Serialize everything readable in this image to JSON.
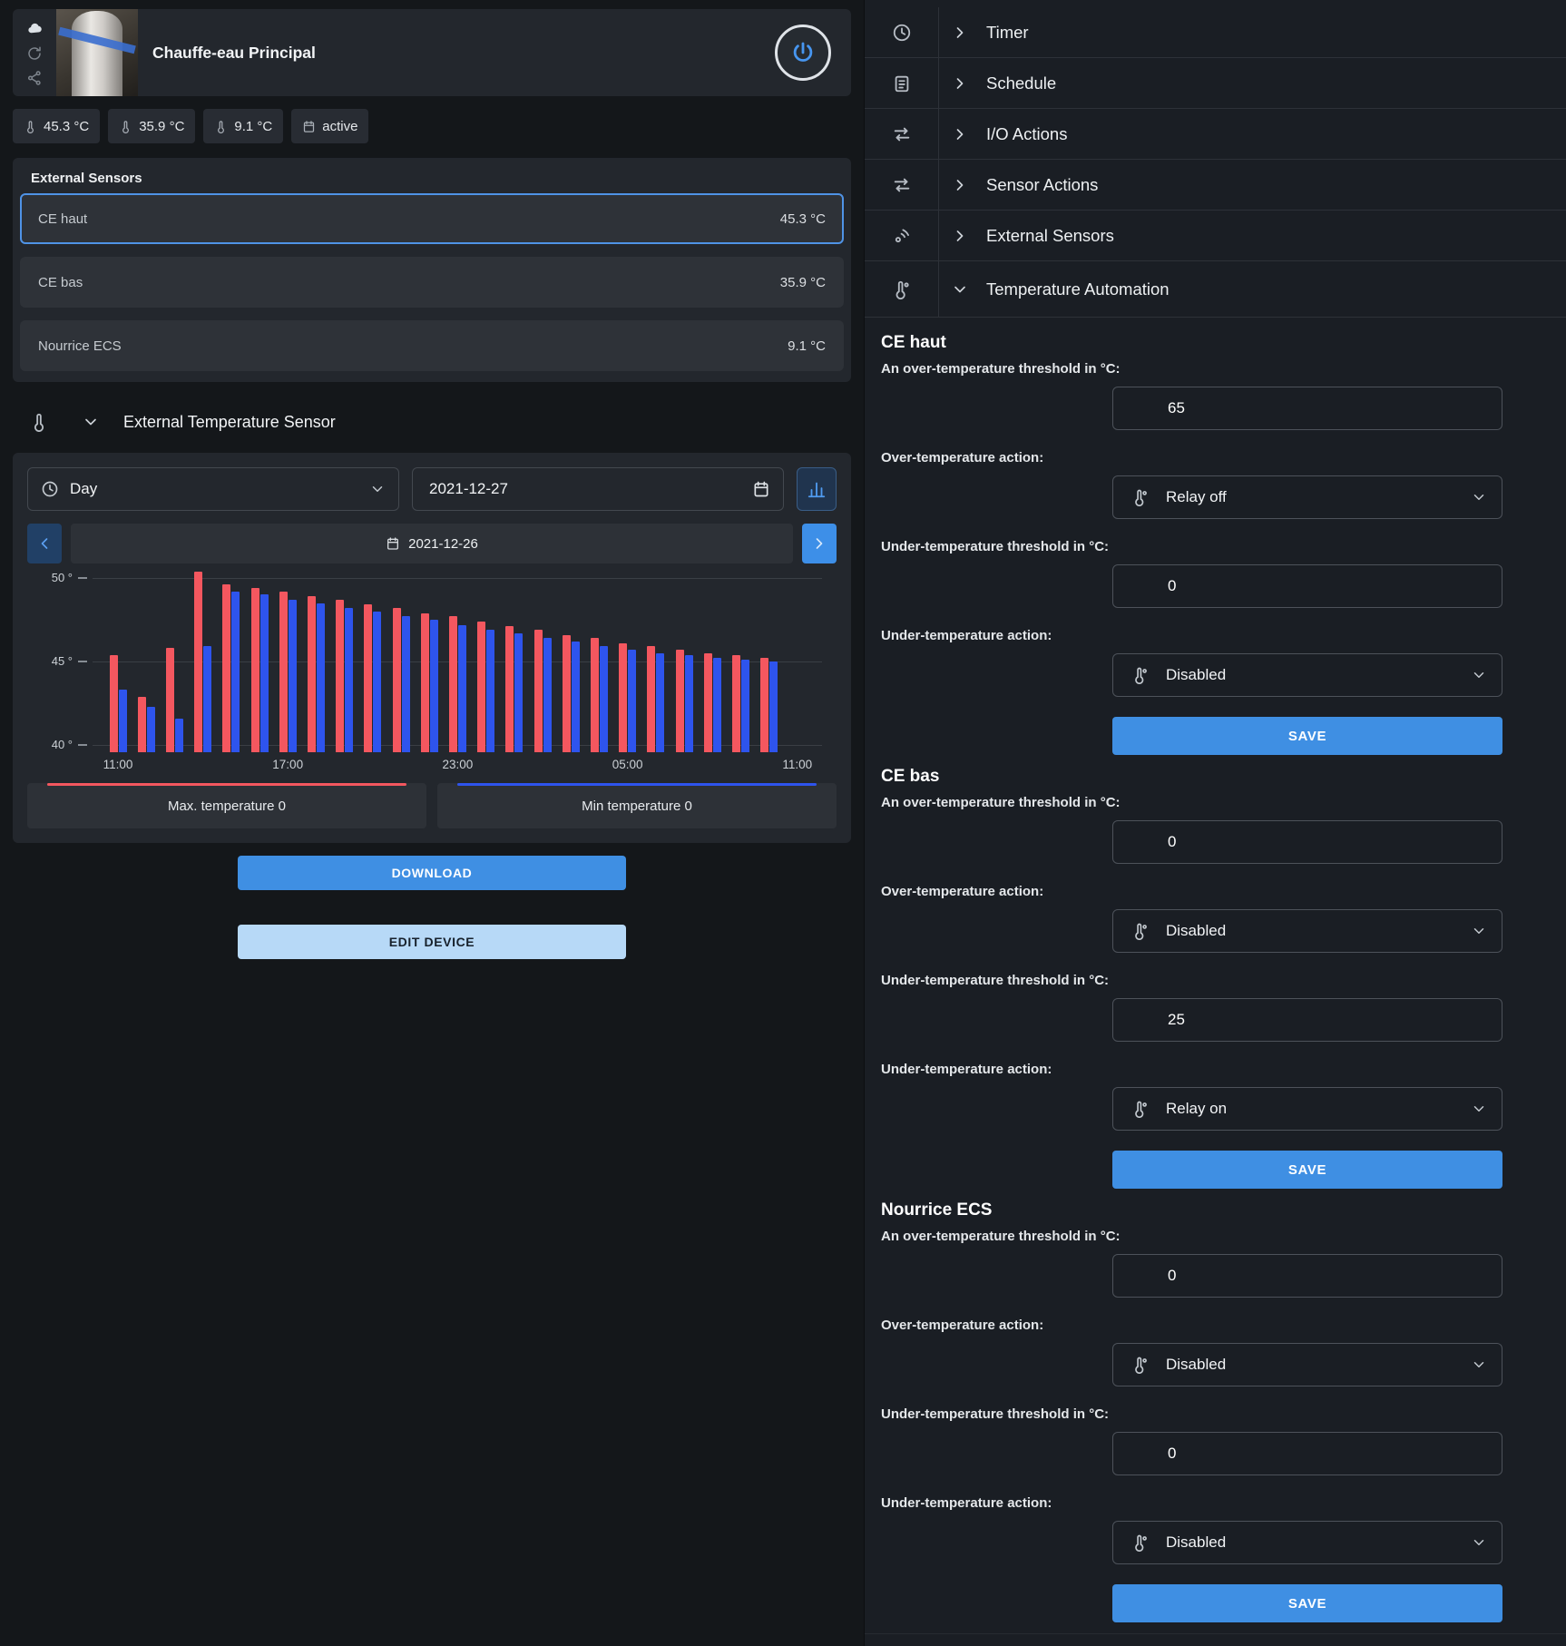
{
  "device": {
    "title": "Chauffe-eau Principal",
    "badges": [
      {
        "label": "45.3 °C"
      },
      {
        "label": "35.9 °C"
      },
      {
        "label": "9.1 °C"
      },
      {
        "label": "active"
      }
    ]
  },
  "external_sensors": {
    "heading": "External Sensors",
    "rows": [
      {
        "name": "CE haut",
        "value": "45.3 °C"
      },
      {
        "name": "CE bas",
        "value": "35.9 °C"
      },
      {
        "name": "Nourrice ECS",
        "value": "9.1 °C"
      }
    ]
  },
  "sensor_panel": {
    "title": "External Temperature Sensor"
  },
  "chart_controls": {
    "period": "Day",
    "date": "2021-12-27",
    "nav_date": "2021-12-26"
  },
  "chart_data": {
    "type": "bar",
    "x": [
      "11:00",
      "12:00",
      "13:00",
      "14:00",
      "15:00",
      "16:00",
      "17:00",
      "18:00",
      "19:00",
      "20:00",
      "21:00",
      "22:00",
      "23:00",
      "00:00",
      "01:00",
      "02:00",
      "03:00",
      "04:00",
      "05:00",
      "06:00",
      "07:00",
      "08:00",
      "09:00",
      "10:00"
    ],
    "series": [
      {
        "name": "Max. temperature",
        "color": "#f4575f",
        "values": [
          45.4,
          42.9,
          45.8,
          50.4,
          49.6,
          49.4,
          49.2,
          48.9,
          48.7,
          48.4,
          48.2,
          47.9,
          47.7,
          47.4,
          47.1,
          46.9,
          46.6,
          46.4,
          46.1,
          45.9,
          45.7,
          45.5,
          45.4,
          45.2
        ]
      },
      {
        "name": "Min temperature",
        "color": "#2e54ed",
        "values": [
          43.3,
          42.3,
          41.6,
          45.9,
          49.2,
          49.0,
          48.7,
          48.5,
          48.2,
          48.0,
          47.7,
          47.5,
          47.2,
          46.9,
          46.7,
          46.4,
          46.2,
          45.9,
          45.7,
          45.5,
          45.4,
          45.2,
          45.1,
          45.0
        ]
      }
    ],
    "xticks": [
      "11:00",
      "17:00",
      "23:00",
      "05:00",
      "11:00"
    ],
    "yticks": [
      40,
      45,
      50
    ],
    "ytick_suffix": " °",
    "ylim": [
      39.5,
      51
    ],
    "grid": true,
    "legend_position": "bottom"
  },
  "legend": {
    "max": "Max. temperature 0",
    "min": "Min temperature 0"
  },
  "actions": {
    "download": "DOWNLOAD",
    "edit": "EDIT DEVICE"
  },
  "menu": {
    "items": [
      {
        "label": "Timer"
      },
      {
        "label": "Schedule"
      },
      {
        "label": "I/O Actions"
      },
      {
        "label": "Sensor Actions"
      },
      {
        "label": "External Sensors"
      },
      {
        "label": "Temperature Automation"
      }
    ]
  },
  "automation": {
    "labels": {
      "over_threshold": "An over-temperature threshold in °C:",
      "over_action": "Over-temperature action:",
      "under_threshold": "Under-temperature threshold in °C:",
      "under_action": "Under-temperature action:",
      "save": "SAVE"
    },
    "sections": [
      {
        "heading": "CE haut",
        "over_value": "65",
        "over_action": "Relay off",
        "under_value": "0",
        "under_action": "Disabled"
      },
      {
        "heading": "CE bas",
        "over_value": "0",
        "over_action": "Disabled",
        "under_value": "25",
        "under_action": "Relay on"
      },
      {
        "heading": "Nourrice ECS",
        "over_value": "0",
        "over_action": "Disabled",
        "under_value": "0",
        "under_action": "Disabled"
      }
    ]
  }
}
